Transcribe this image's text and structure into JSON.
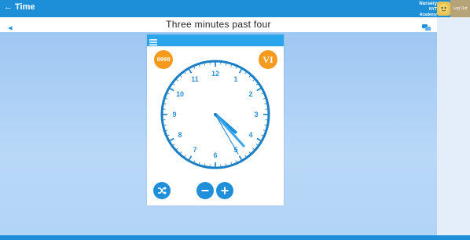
{
  "app": {
    "back_label": "Time"
  },
  "user": {
    "name": "Nursery",
    "org": "NYT Academy",
    "logout_label": "Log Out"
  },
  "question": {
    "text": "Three minutes past four"
  },
  "clock": {
    "numerals": [
      "12",
      "1",
      "2",
      "3",
      "4",
      "5",
      "6",
      "7",
      "8",
      "9",
      "10",
      "11"
    ],
    "hour": 4,
    "minute": 23,
    "second": 25
  },
  "controls": {
    "digital_label": "0000",
    "roman_label": "VI"
  },
  "colors": {
    "topbar": "#1c8fd8",
    "accent_orange": "#f59a1d",
    "clock_blue": "#1f8fda"
  }
}
